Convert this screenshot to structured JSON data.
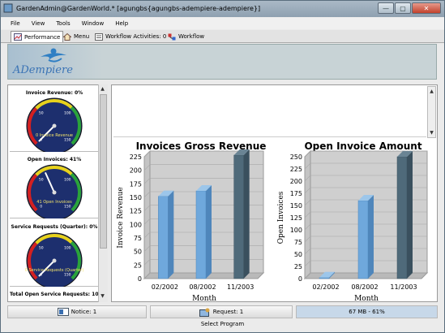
{
  "window": {
    "title": "GardenAdmin@GardenWorld.* [agungbs{agungbs-adempiere-adempiere}]",
    "controls": {
      "minimize": "—",
      "maximize": "▢",
      "close": "✕"
    }
  },
  "menu": [
    "File",
    "View",
    "Tools",
    "Window",
    "Help"
  ],
  "tabs": [
    {
      "label": "Performance",
      "icon": "performance-icon"
    },
    {
      "label": "Menu",
      "icon": "home-icon"
    },
    {
      "label": "Workflow Activities: 0",
      "icon": "workflow-activities-icon"
    },
    {
      "label": "Workflow",
      "icon": "workflow-icon"
    }
  ],
  "banner": {
    "logo": "ADempiere"
  },
  "gauges": [
    {
      "title": "Invoice Revenue: 0%",
      "value_label": "0 Invoice Revenue",
      "level": 0.0,
      "min": "0",
      "max": "150",
      "ticks": [
        "0",
        "50",
        "100",
        "150"
      ]
    },
    {
      "title": "Open Invoices: 41%",
      "value_label": "41 Open Invoices",
      "level": 0.41,
      "min": "0",
      "max": "150",
      "ticks": [
        "0",
        "50",
        "100",
        "150"
      ]
    },
    {
      "title": "Service Requests (Quarter): 0%",
      "value_label": "0 Service Requests (Quarter)",
      "level": 0.0,
      "min": "0",
      "max": "150",
      "ticks": [
        "0",
        "50",
        "100",
        "150"
      ]
    },
    {
      "title": "Total Open Service Requests: 10%"
    }
  ],
  "chart_data": [
    {
      "type": "bar",
      "title": "Invoices Gross Revenue",
      "xlabel": "Month",
      "ylabel": "Invoice Revenue",
      "categories": [
        "02/2002",
        "08/2002",
        "11/2003"
      ],
      "values": [
        152,
        162,
        228
      ],
      "ylim": [
        0,
        225
      ],
      "yticks": [
        0,
        25,
        50,
        75,
        100,
        125,
        150,
        175,
        200,
        225
      ],
      "colors": [
        "#6fa8dc",
        "#6fa8dc",
        "#4f6a7a"
      ],
      "grid": true
    },
    {
      "type": "bar",
      "title": "Open Invoice Amount",
      "xlabel": "Month",
      "ylabel": "Open Invoices",
      "categories": [
        "02/2002",
        "08/2002",
        "11/2003"
      ],
      "values": [
        2,
        160,
        250
      ],
      "ylim": [
        0,
        250
      ],
      "yticks": [
        0,
        25,
        50,
        75,
        100,
        125,
        150,
        175,
        200,
        225,
        250
      ],
      "colors": [
        "#6fa8dc",
        "#6fa8dc",
        "#4f6a7a"
      ],
      "grid": true
    }
  ],
  "status": {
    "notice": "Notice: 1",
    "request": "Request: 1",
    "memory": "67 MB - 61%",
    "bottom": "Select Program"
  }
}
